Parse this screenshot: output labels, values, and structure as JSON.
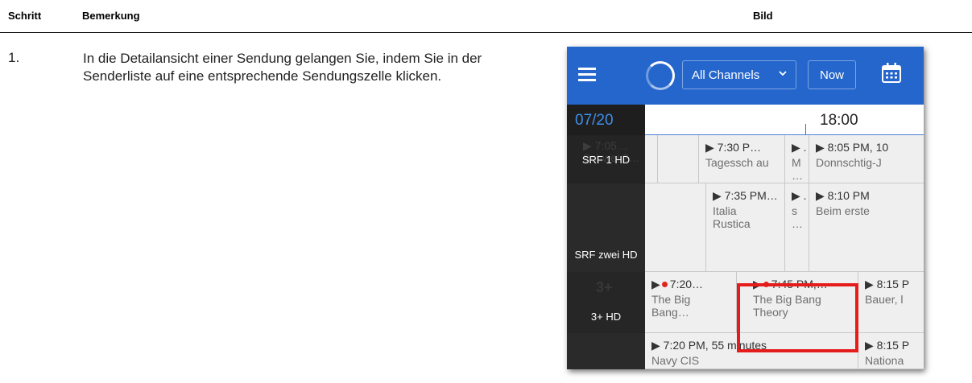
{
  "table": {
    "col_step": "Schritt",
    "col_note": "Bemerkung",
    "col_image": "Bild",
    "step_number": "1.",
    "step_text": "In die Detailansicht einer Sendung gelangen Sie, indem Sie in der Senderliste auf eine entsprechende Sendungszelle klicken."
  },
  "app": {
    "toolbar": {
      "channel_filter": "All Channels",
      "now_button": "Now",
      "color": "#2566cc"
    },
    "date": "07/20",
    "time_label": "18:00",
    "rows": [
      {
        "channel": "SRF 1 HD",
        "ghost_text": "▶ 7:05… Schwei 2…",
        "cells": [
          {
            "time": "▶ 7:30 P…",
            "name": "Tagessch au"
          },
          {
            "time": "▶ .",
            "name": "M …"
          },
          {
            "time": "▶ 8:05 PM, 10",
            "name": "Donnschtig-J"
          }
        ]
      },
      {
        "channel": "SRF zwei HD",
        "cells": [
          {
            "time": "▶ 7:35 PM…",
            "name": "Italia Rustica"
          },
          {
            "time": "▶ .",
            "name": "s …"
          },
          {
            "time": "▶ 8:10 PM",
            "name": "Beim erste"
          }
        ]
      },
      {
        "channel": "3+ HD",
        "ghost_text": "3+",
        "cells": [
          {
            "prefix": "▶",
            "time": "7:20…",
            "name": "The Big Bang…"
          },
          {
            "prefix": "▶",
            "time": "7:45 PM,…",
            "name": "The Big Bang Theory"
          },
          {
            "time": "▶ 8:15 P",
            "name": "Bauer, l"
          }
        ]
      },
      {
        "channel": "",
        "cells": [
          {
            "time": "▶ 7:20 PM, 55 minutes",
            "name": "Navy CIS"
          },
          {
            "time": "▶ 8:15 P",
            "name": "Nationa"
          }
        ]
      }
    ],
    "accent_color": "#e51c1c",
    "date_color": "#3f8fe8"
  }
}
